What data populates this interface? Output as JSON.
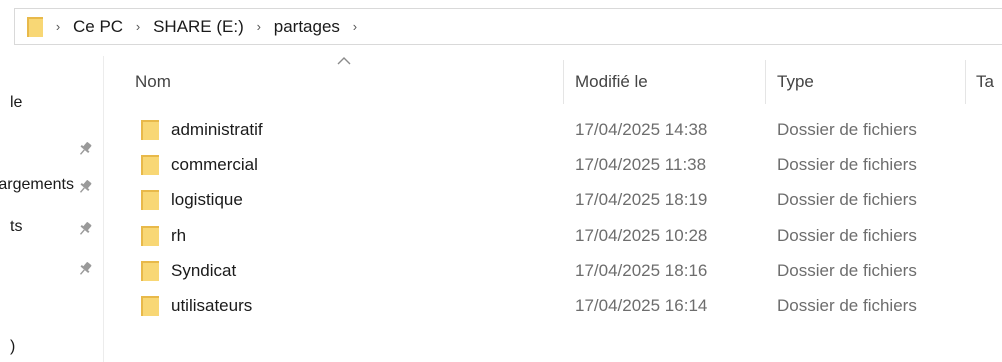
{
  "breadcrumb": {
    "items": [
      "Ce PC",
      "SHARE (E:)",
      "partages"
    ],
    "separator": "›",
    "folder_icon": "folder-icon"
  },
  "nav": {
    "items": [
      {
        "label": "le",
        "pinned": false
      },
      {
        "label": "",
        "pinned": true
      },
      {
        "label": "éléchargements",
        "pinned": true
      },
      {
        "label": "ts",
        "pinned": true
      },
      {
        "label": "",
        "pinned": true
      },
      {
        "label": ")",
        "pinned": false
      }
    ],
    "pin_icon": "pin-icon"
  },
  "columns": {
    "name": "Nom",
    "modified": "Modifié le",
    "type": "Type",
    "size": "Ta"
  },
  "files": [
    {
      "name": "administratif",
      "modified": "17/04/2025 14:38",
      "type": "Dossier de fichiers"
    },
    {
      "name": "commercial",
      "modified": "17/04/2025 11:38",
      "type": "Dossier de fichiers"
    },
    {
      "name": "logistique",
      "modified": "17/04/2025 18:19",
      "type": "Dossier de fichiers"
    },
    {
      "name": "rh",
      "modified": "17/04/2025 10:28",
      "type": "Dossier de fichiers"
    },
    {
      "name": "Syndicat",
      "modified": "17/04/2025 18:16",
      "type": "Dossier de fichiers"
    },
    {
      "name": "utilisateurs",
      "modified": "17/04/2025 16:14",
      "type": "Dossier de fichiers"
    }
  ],
  "colors": {
    "folder_front": "#f8d775",
    "folder_back": "#e8b94a",
    "secondary_text": "#6d6d6d",
    "border": "#d9d9d9"
  }
}
